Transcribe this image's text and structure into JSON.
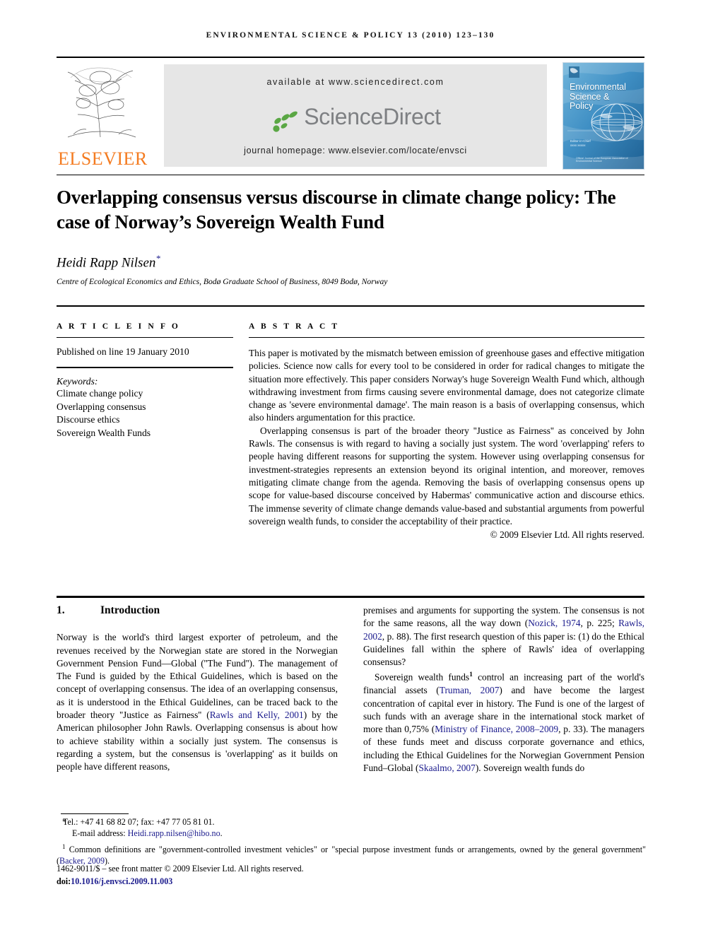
{
  "running_head": "ENVIRONMENTAL SCIENCE & POLICY 13 (2010) 123–130",
  "banner": {
    "publisher_name": "ELSEVIER",
    "available_at": "available at www.sciencedirect.com",
    "sciencedirect_word": "ScienceDirect",
    "journal_homepage": "journal homepage: www.elsevier.com/locate/envsci",
    "cover": {
      "title_line1": "Environmental",
      "title_line2": "Science &",
      "title_line3": "Policy",
      "editors_label": "Editor-in-Chief",
      "editors_name": "xxxx xxxxx",
      "footer_note": "Official Journal of the European Association of Environmental Science"
    },
    "colors": {
      "elsevier_orange": "#F47B20",
      "sciencedirect_green": "#5aa744",
      "sciencedirect_gray": "#7e8083",
      "cover_blue": "#3f8fc4",
      "banner_gray": "#e6e6e6"
    }
  },
  "article": {
    "title": "Overlapping consensus versus discourse in climate change policy: The case of Norway’s Sovereign Wealth Fund",
    "author": "Heidi Rapp Nilsen",
    "author_marker": "*",
    "affiliation": "Centre of Ecological Economics and Ethics, Bodø Graduate School of Business, 8049 Bodø, Norway"
  },
  "info": {
    "section_label": "A R T I C L E   I N F O",
    "history": "Published on line 19 January 2010",
    "keywords_label": "Keywords:",
    "keywords": [
      "Climate change policy",
      "Overlapping consensus",
      "Discourse ethics",
      "Sovereign Wealth Funds"
    ]
  },
  "abstract": {
    "section_label": "A B S T R A C T",
    "paragraph1": "This paper is motivated by the mismatch between emission of greenhouse gases and effective mitigation policies. Science now calls for every tool to be considered in order for radical changes to mitigate the situation more effectively. This paper considers Norway's huge Sovereign Wealth Fund which, although withdrawing investment from firms causing severe environmental damage, does not categorize climate change as 'severe environmental damage'. The main reason is a basis of overlapping consensus, which also hinders argumentation for this practice.",
    "paragraph2": "Overlapping consensus is part of the broader theory ''Justice as Fairness'' as conceived by John Rawls. The consensus is with regard to having a socially just system. The word 'overlapping' refers to people having different reasons for supporting the system. However using overlapping consensus for investment-strategies represents an extension beyond its original intention, and moreover, removes mitigating climate change from the agenda. Removing the basis of overlapping consensus opens up scope for value-based discourse conceived by Habermas' communicative action and discourse ethics. The immense severity of climate change demands value-based and substantial arguments from powerful sovereign wealth funds, to consider the acceptability of their practice.",
    "copyright": "© 2009 Elsevier Ltd. All rights reserved."
  },
  "body": {
    "section_number": "1.",
    "section_title": "Introduction",
    "left_column": {
      "part1": "Norway is the world's third largest exporter of petroleum, and the revenues received by the Norwegian state are stored in the Norwegian Government Pension Fund—Global (''The Fund''). The management of The Fund is guided by the Ethical Guidelines, which is based on the concept of overlapping consensus. The idea of an overlapping consensus, as it is understood in the Ethical Guidelines, can be traced back to the broader theory ''Justice as Fairness'' (",
      "citation1": "Rawls and Kelly, 2001",
      "part2": ") by the American philosopher John Rawls. Overlapping consensus is about how to achieve stability within a socially just system. The consensus is regarding a system, but the consensus is 'overlapping' as it builds on people have different reasons,"
    },
    "right_column": {
      "p1_part1": "premises and arguments for supporting the system. The consensus is not for the same reasons, all the way down (",
      "p1_cite1": "Nozick, 1974",
      "p1_part2": ", p. 225; ",
      "p1_cite2": "Rawls, 2002",
      "p1_part3": ", p. 88). The first research question of this paper is: (1) do the Ethical Guidelines fall within the sphere of Rawls' idea of overlapping consensus?",
      "p2_part1": "Sovereign wealth funds",
      "p2_footnote_marker": "1",
      "p2_part2": " control an increasing part of the world's financial assets (",
      "p2_cite1": "Truman, 2007",
      "p2_part3": ") and have become the largest concentration of capital ever in history. The Fund is one of the largest of such funds with an average share in the international stock market of more than 0,75% (",
      "p2_cite2": "Ministry of Finance, 2008–2009",
      "p2_part4": ", p. 33). The managers of these funds meet and discuss corporate governance and ethics, including the Ethical Guidelines for the Norwegian Government Pension Fund–Global (",
      "p2_cite3": "Skaalmo, 2007",
      "p2_part5": "). Sovereign wealth funds do"
    }
  },
  "footnotes": {
    "tel_marker": "*",
    "tel": "Tel.: +47 41 68 82 07; fax: +47 77 05 81 01.",
    "email_label": "E-mail address:",
    "email": "Heidi.rapp.nilsen@hibo.no",
    "fn1_marker": "1",
    "fn1_part1": "Common definitions are \"government-controlled investment vehicles\" or \"special purpose investment funds or arrangements, owned by the general government\" (",
    "fn1_cite": "Backer, 2009",
    "fn1_part2": ").",
    "issn_line": "1462-9011/$ – see front matter © 2009 Elsevier Ltd. All rights reserved.",
    "doi_label": "doi:",
    "doi_value": "10.1016/j.envsci.2009.11.003"
  }
}
